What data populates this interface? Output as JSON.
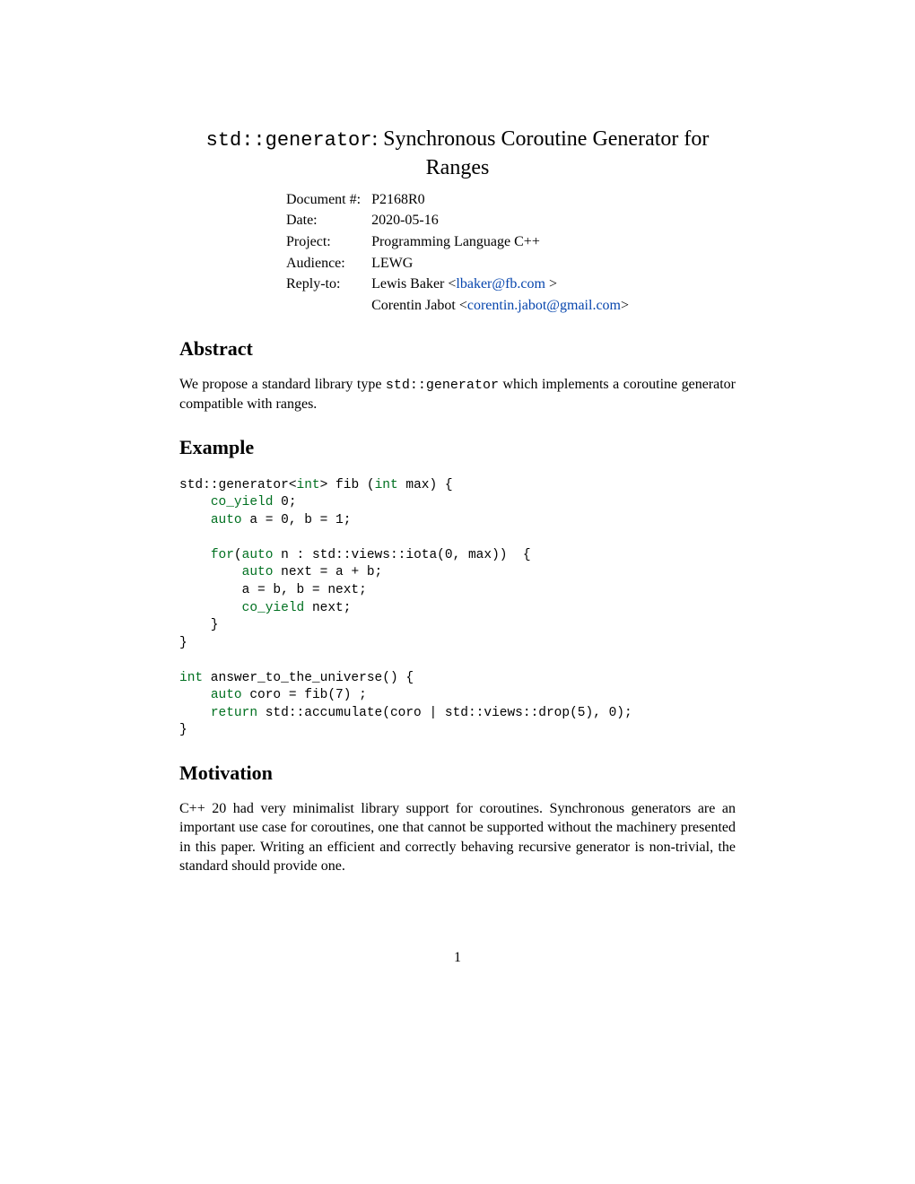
{
  "title_code": "std::generator",
  "title_rest": ": Synchronous Coroutine Generator for Ranges",
  "meta": {
    "doc_label": "Document #:",
    "doc_value": "P2168R0",
    "date_label": "Date:",
    "date_value": "2020-05-16",
    "project_label": "Project:",
    "project_value": "Programming Language C++",
    "audience_label": "Audience:",
    "audience_value": "LEWG",
    "reply_label": "Reply-to:",
    "reply_name1": "Lewis Baker <",
    "reply_email1": "lbaker@fb.com ",
    "reply_close1": ">",
    "reply_name2": "Corentin Jabot <",
    "reply_email2": "corentin.jabot@gmail.com",
    "reply_close2": ">"
  },
  "abstract": {
    "heading": "Abstract",
    "p1a": "We propose a standard library type ",
    "p1_code": "std::generator",
    "p1b": " which implements a coroutine generator compatible with ranges."
  },
  "example": {
    "heading": "Example",
    "c01": "std::generator<",
    "c02": "int",
    "c03": "> fib (",
    "c04": "int",
    "c05": " max) {",
    "c06": "    ",
    "c07": "co_yield",
    "c08": " 0;",
    "c09": "    ",
    "c10": "auto",
    "c11": " a = 0, b = 1;",
    "c12": "    ",
    "c13": "for",
    "c14": "(",
    "c15": "auto",
    "c16": " n : std::views::iota(0, max))  {",
    "c17": "        ",
    "c18": "auto",
    "c19": " next = a + b;",
    "c20": "        a = b, b = next;",
    "c21": "        ",
    "c22": "co_yield",
    "c23": " next;",
    "c24": "    }",
    "c25": "}",
    "c26": "int",
    "c27": " answer_to_the_universe() {",
    "c28": "    ",
    "c29": "auto",
    "c30": " coro = fib(7) ;",
    "c31": "    ",
    "c32": "return",
    "c33": " std::accumulate(coro | std::views::drop(5), 0);",
    "c34": "}"
  },
  "motivation": {
    "heading": "Motivation",
    "p1": "C++ 20 had very minimalist library support for coroutines. Synchronous generators are an important use case for coroutines, one that cannot be supported without the machinery presented in this paper. Writing an efficient and correctly behaving recursive generator is non-trivial, the standard should provide one."
  },
  "page_number": "1"
}
